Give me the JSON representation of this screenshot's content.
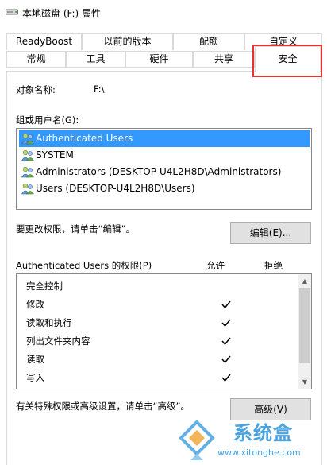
{
  "window": {
    "title": "本地磁盘 (F:) 属性"
  },
  "tabs": {
    "row1": [
      "ReadyBoost",
      "以前的版本",
      "配额",
      "自定义"
    ],
    "row2": [
      "常规",
      "工具",
      "硬件",
      "共享",
      "安全"
    ],
    "active": "安全"
  },
  "object": {
    "label": "对象名称:",
    "value": "F:\\"
  },
  "groups": {
    "label": "组或用户名(G):",
    "items": [
      "Authenticated Users",
      "SYSTEM",
      "Administrators (DESKTOP-U4L2H8D\\Administrators)",
      "Users (DESKTOP-U4L2H8D\\Users)"
    ],
    "selected_index": 0
  },
  "edit": {
    "hint": "要更改权限，请单击“编辑”。",
    "button": "编辑(E)..."
  },
  "permissions": {
    "header": "Authenticated Users 的权限(P)",
    "allow_label": "允许",
    "deny_label": "拒绝",
    "rows": [
      {
        "name": "完全控制",
        "allow": false,
        "deny": false
      },
      {
        "name": "修改",
        "allow": true,
        "deny": false
      },
      {
        "name": "读取和执行",
        "allow": true,
        "deny": false
      },
      {
        "name": "列出文件夹内容",
        "allow": true,
        "deny": false
      },
      {
        "name": "读取",
        "allow": true,
        "deny": false
      },
      {
        "name": "写入",
        "allow": true,
        "deny": false
      }
    ]
  },
  "advanced": {
    "hint": "有关特殊权限或高级设置，请单击“高级”。",
    "button": "高级(V)"
  },
  "watermark": {
    "brand": "系统盒",
    "url": "www.xitonghe.com"
  },
  "colors": {
    "highlight": "#3399ff",
    "annotation": "#e53333",
    "watermark": "#4aa3df"
  }
}
